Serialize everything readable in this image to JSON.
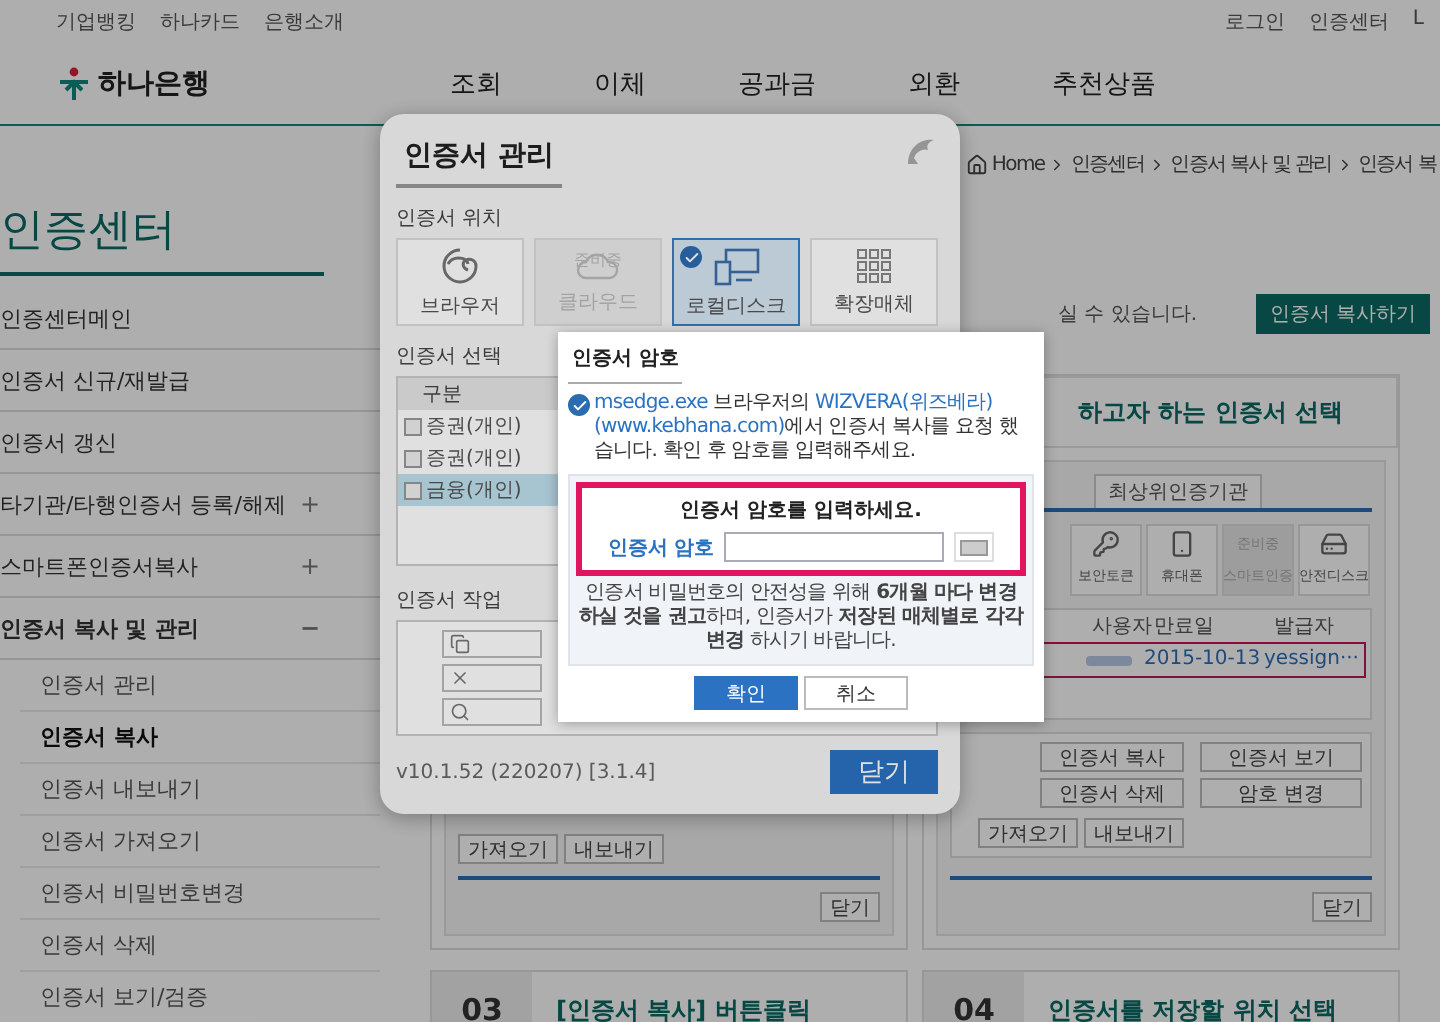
{
  "top_bar": {
    "left_links": [
      "기업뱅킹",
      "하나카드",
      "은행소개"
    ],
    "right_links": [
      "로그인",
      "인증센터",
      "L"
    ]
  },
  "logo": "하나은행",
  "nav": [
    "조회",
    "이체",
    "공과금",
    "외환",
    "추천상품"
  ],
  "sidebar": {
    "title": "인증센터",
    "items": [
      {
        "label": "인증센터메인"
      },
      {
        "label": "인증서 신규/재발급"
      },
      {
        "label": "인증서 갱신"
      },
      {
        "label": "타기관/타행인증서 등록/해제",
        "toggle": "+",
        "expanded": false
      },
      {
        "label": "스마트폰인증서복사",
        "toggle": "+",
        "expanded": false
      },
      {
        "label": "인증서 복사 및 관리",
        "toggle": "−",
        "expanded": true,
        "children": [
          {
            "label": "인증서 관리",
            "selected": false
          },
          {
            "label": "인증서 복사",
            "selected": true
          },
          {
            "label": "인증서 내보내기",
            "selected": false
          },
          {
            "label": "인증서 가져오기",
            "selected": false
          },
          {
            "label": "인증서 비밀번호변경",
            "selected": false
          },
          {
            "label": "인증서 삭제",
            "selected": false
          },
          {
            "label": "인증서 보기/검증",
            "selected": false
          }
        ]
      }
    ]
  },
  "content": {
    "breadcrumb": [
      "Home",
      "인증센터",
      "인증서 복사 및 관리",
      "인증서 복"
    ],
    "intro_tail": "실 수 있습니다.",
    "copy_button": "인증서 복사하기",
    "step_cards": [
      {
        "kind": "covered",
        "buttons": [
          "가져오기",
          "내보내기"
        ],
        "close": "닫기"
      },
      {
        "kind": "full",
        "title": "하고자 하는 인증서 선택",
        "tab": "최상위인증기관",
        "media": [
          {
            "label": "보안토큰",
            "disabled": false
          },
          {
            "label": "휴대폰",
            "disabled": false
          },
          {
            "label": "스마트인증",
            "disabled": true,
            "badge": "준비중"
          },
          {
            "label": "안전디스크",
            "disabled": false
          }
        ],
        "columns": [
          "사용자",
          "만료일",
          "발급자"
        ],
        "row": {
          "expiry": "2015-10-13",
          "issuer": "yessign···"
        },
        "left_buttons": [
          "인증서 복사",
          "인증서 삭제"
        ],
        "small_buttons": [
          "가져오기",
          "내보내기"
        ],
        "right_buttons": [
          "인증서 보기",
          "암호 변경"
        ],
        "close": "닫기"
      }
    ],
    "bottom_steps": [
      {
        "number": "03",
        "title": "[인증서 복사] 버튼클릭"
      },
      {
        "number": "04",
        "title": "인증서를 저장할 위치 선택"
      }
    ]
  },
  "cert_manager": {
    "title": "인증서 관리",
    "location_label": "인증서 위치",
    "locations": [
      {
        "kind": "browser",
        "label": "브라우저",
        "selected": false,
        "disabled": false
      },
      {
        "kind": "cloud",
        "label": "클라우드",
        "badge": "준비중",
        "selected": false,
        "disabled": true
      },
      {
        "kind": "local",
        "label": "로컬디스크",
        "selected": true,
        "disabled": false
      },
      {
        "kind": "external",
        "label": "확장매체",
        "selected": false,
        "disabled": false
      }
    ],
    "select_label": "인증서 선택",
    "table_column": "구분",
    "certs": [
      {
        "label": "증권(개인)",
        "selected": false
      },
      {
        "label": "증권(개인)",
        "selected": false
      },
      {
        "label": "금융(개인)",
        "selected": true
      }
    ],
    "work_label": "인증서 작업",
    "version": "v10.1.52 (220207) [3.1.4]",
    "close_button": "닫기"
  },
  "password_dialog": {
    "title": "인증서 암호",
    "notice": [
      {
        "text": "msedge.exe",
        "highlight": true
      },
      {
        "text": " 브라우저의 ",
        "highlight": false
      },
      {
        "text": "WIZVERA(위즈베라)(www.kebhana.com)",
        "highlight": true
      },
      {
        "text": "에서 인증서 복사를 요청 했습니다. 확인 후 암호를 입력해주세요.",
        "highlight": false
      }
    ],
    "prompt": "인증서 암호를 입력하세요.",
    "field_label": "인증서 암호",
    "advice": "인증서 비밀번호의 안전성을 위해 **6개월 마다 변경하실 것을 권고**하며, 인증서가 **저장된 매체별로 각각 변경** 하시기 바랍니다.",
    "buttons": [
      {
        "label": "확인",
        "primary": true
      },
      {
        "label": "취소",
        "primary": false
      }
    ]
  }
}
